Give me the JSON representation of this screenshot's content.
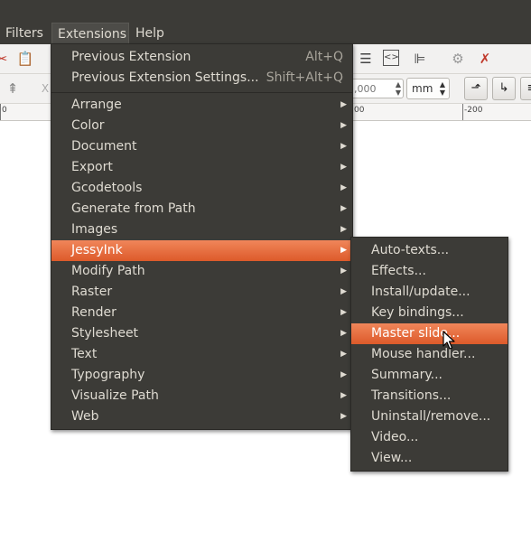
{
  "menubar": {
    "items": [
      {
        "label": "Filters"
      },
      {
        "label": "Extensions"
      },
      {
        "label": "Help"
      }
    ]
  },
  "toolbar": {
    "spin_value": ",000",
    "unit": "mm"
  },
  "ruler": {
    "left_tick": "0",
    "mid_tick": "00",
    "right_tick": "-200"
  },
  "extensions_menu": {
    "top_items": [
      {
        "label": "Previous Extension",
        "accel": "Alt+Q"
      },
      {
        "label": "Previous Extension Settings...",
        "accel": "Shift+Alt+Q"
      }
    ],
    "items": [
      {
        "label": "Arrange"
      },
      {
        "label": "Color"
      },
      {
        "label": "Document"
      },
      {
        "label": "Export"
      },
      {
        "label": "Gcodetools"
      },
      {
        "label": "Generate from Path"
      },
      {
        "label": "Images"
      },
      {
        "label": "JessyInk"
      },
      {
        "label": "Modify Path"
      },
      {
        "label": "Raster"
      },
      {
        "label": "Render"
      },
      {
        "label": "Stylesheet"
      },
      {
        "label": "Text"
      },
      {
        "label": "Typography"
      },
      {
        "label": "Visualize Path"
      },
      {
        "label": "Web"
      }
    ]
  },
  "jessyink_submenu": {
    "items": [
      {
        "label": "Auto-texts..."
      },
      {
        "label": "Effects..."
      },
      {
        "label": "Install/update..."
      },
      {
        "label": "Key bindings..."
      },
      {
        "label": "Master slide..."
      },
      {
        "label": "Mouse handler..."
      },
      {
        "label": "Summary..."
      },
      {
        "label": "Transitions..."
      },
      {
        "label": "Uninstall/remove..."
      },
      {
        "label": "Video..."
      },
      {
        "label": "View..."
      }
    ]
  },
  "colors": {
    "menu_bg": "#3c3b37",
    "highlight": "#e9683a",
    "menu_text": "#dfdbd2"
  }
}
